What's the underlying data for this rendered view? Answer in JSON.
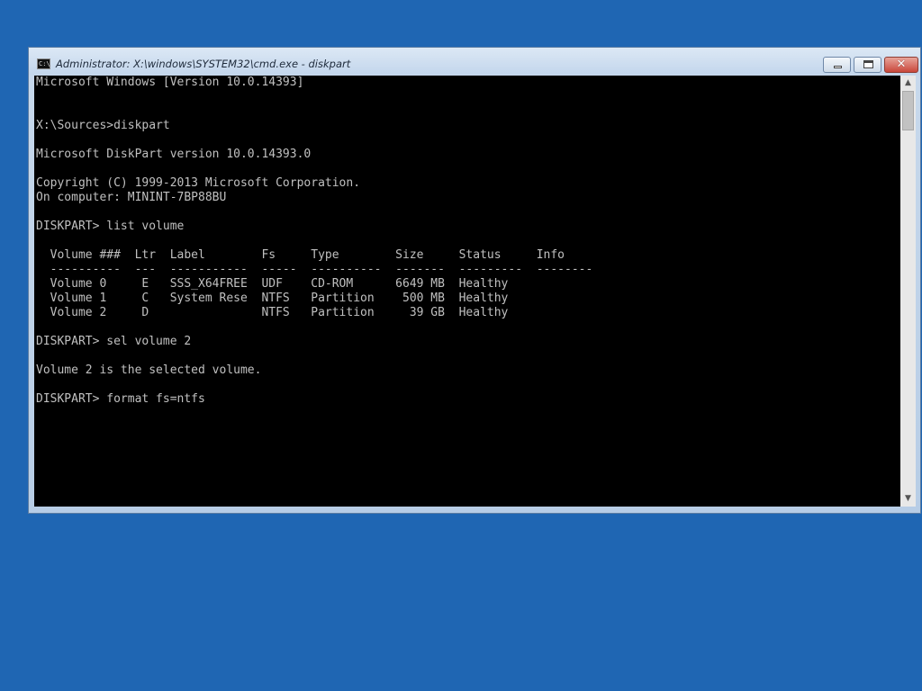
{
  "window": {
    "title": "Administrator: X:\\windows\\SYSTEM32\\cmd.exe - diskpart",
    "icon_label": "C:\\",
    "controls": {
      "minimize_icon": "minimize-icon",
      "maximize_icon": "maximize-icon",
      "close_glyph": "✕"
    }
  },
  "console": {
    "lines": [
      "Microsoft Windows [Version 10.0.14393]",
      "",
      "",
      "X:\\Sources>diskpart",
      "",
      "Microsoft DiskPart version 10.0.14393.0",
      "",
      "Copyright (C) 1999-2013 Microsoft Corporation.",
      "On computer: MININT-7BP88BU",
      "",
      "DISKPART> list volume",
      "",
      "  Volume ###  Ltr  Label        Fs     Type        Size     Status     Info",
      "  ----------  ---  -----------  -----  ----------  -------  ---------  --------",
      "  Volume 0     E   SSS_X64FREE  UDF    CD-ROM      6649 MB  Healthy",
      "  Volume 1     C   System Rese  NTFS   Partition    500 MB  Healthy",
      "  Volume 2     D                NTFS   Partition     39 GB  Healthy",
      "",
      "DISKPART> sel volume 2",
      "",
      "Volume 2 is the selected volume.",
      "",
      "DISKPART> format fs=ntfs"
    ]
  },
  "scrollbar": {
    "up_glyph": "▲",
    "down_glyph": "▼"
  }
}
